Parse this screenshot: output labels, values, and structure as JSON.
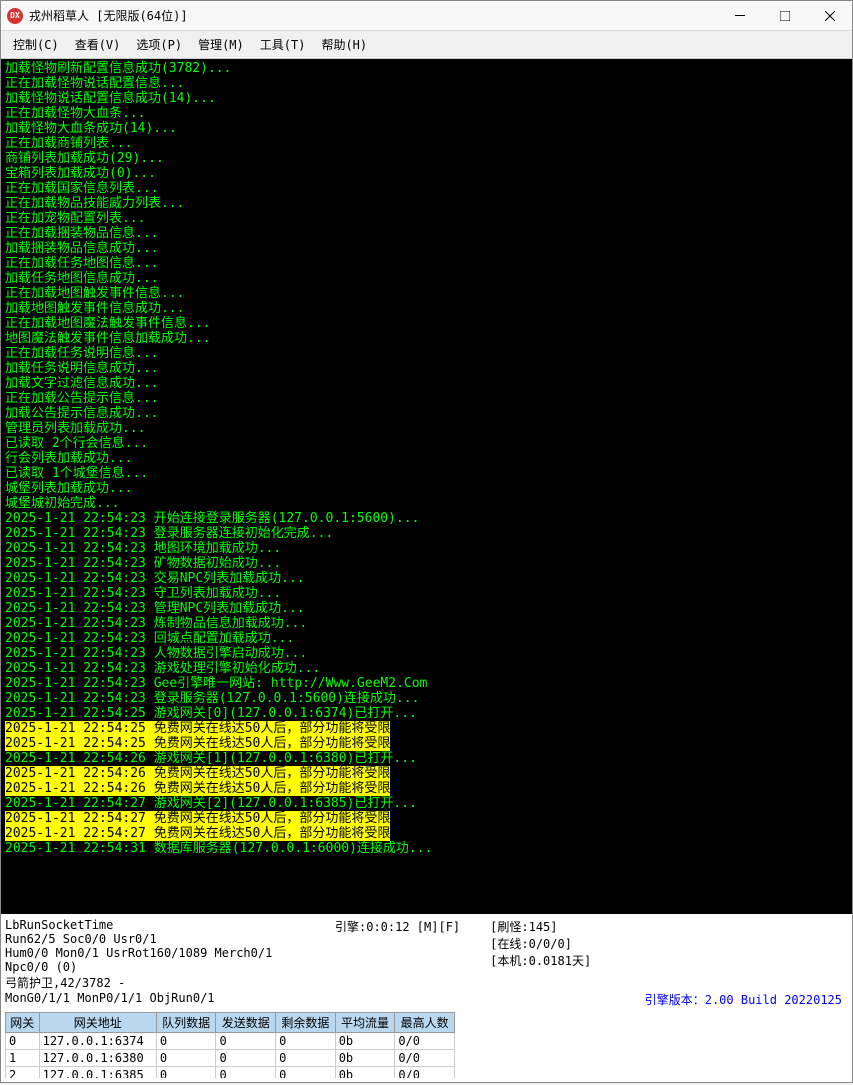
{
  "window": {
    "app_icon": "DX",
    "title": "戎州稻草人 [无限版(64位)]"
  },
  "menu": {
    "control": "控制(C)",
    "view": "查看(V)",
    "options": "选项(P)",
    "manage": "管理(M)",
    "tools": "工具(T)",
    "help": "帮助(H)"
  },
  "log_lines": [
    {
      "t": "加载怪物刷新配置信息成功(3782)...",
      "hl": false
    },
    {
      "t": "正在加载怪物说话配置信息...",
      "hl": false
    },
    {
      "t": "加载怪物说话配置信息成功(14)...",
      "hl": false
    },
    {
      "t": "正在加载怪物大血条...",
      "hl": false
    },
    {
      "t": "加载怪物大血条成功(14)...",
      "hl": false
    },
    {
      "t": "正在加载商铺列表...",
      "hl": false
    },
    {
      "t": "商铺列表加载成功(29)...",
      "hl": false
    },
    {
      "t": "宝箱列表加载成功(0)...",
      "hl": false
    },
    {
      "t": "正在加载国家信息列表...",
      "hl": false
    },
    {
      "t": "正在加载物品技能威力列表...",
      "hl": false
    },
    {
      "t": "正在加宠物配置列表...",
      "hl": false
    },
    {
      "t": "正在加载捆装物品信息...",
      "hl": false
    },
    {
      "t": "加载捆装物品信息成功...",
      "hl": false
    },
    {
      "t": "正在加载任务地图信息...",
      "hl": false
    },
    {
      "t": "加载任务地图信息成功...",
      "hl": false
    },
    {
      "t": "正在加载地图触发事件信息...",
      "hl": false
    },
    {
      "t": "加载地图触发事件信息成功...",
      "hl": false
    },
    {
      "t": "正在加载地图魔法触发事件信息...",
      "hl": false
    },
    {
      "t": "地图魔法触发事件信息加载成功...",
      "hl": false
    },
    {
      "t": "正在加载任务说明信息...",
      "hl": false
    },
    {
      "t": "加载任务说明信息成功...",
      "hl": false
    },
    {
      "t": "加载文字过滤信息成功...",
      "hl": false
    },
    {
      "t": "正在加载公告提示信息...",
      "hl": false
    },
    {
      "t": "加载公告提示信息成功...",
      "hl": false
    },
    {
      "t": "管理员列表加载成功...",
      "hl": false
    },
    {
      "t": "已读取 2个行会信息...",
      "hl": false
    },
    {
      "t": "行会列表加载成功...",
      "hl": false
    },
    {
      "t": "已读取 1个城堡信息...",
      "hl": false
    },
    {
      "t": "城堡列表加载成功...",
      "hl": false
    },
    {
      "t": "城堡城初始完成...",
      "hl": false
    },
    {
      "t": "2025-1-21 22:54:23 开始连接登录服务器(127.0.0.1:5600)...",
      "hl": false
    },
    {
      "t": "2025-1-21 22:54:23 登录服务器连接初始化完成...",
      "hl": false
    },
    {
      "t": "2025-1-21 22:54:23 地图环境加载成功...",
      "hl": false
    },
    {
      "t": "2025-1-21 22:54:23 矿物数据初始成功...",
      "hl": false
    },
    {
      "t": "2025-1-21 22:54:23 交易NPC列表加载成功...",
      "hl": false
    },
    {
      "t": "2025-1-21 22:54:23 守卫列表加载成功...",
      "hl": false
    },
    {
      "t": "2025-1-21 22:54:23 管理NPC列表加载成功...",
      "hl": false
    },
    {
      "t": "2025-1-21 22:54:23 炼制物品信息加载成功...",
      "hl": false
    },
    {
      "t": "2025-1-21 22:54:23 回城点配置加载成功...",
      "hl": false
    },
    {
      "t": "2025-1-21 22:54:23 人物数据引擎启动成功...",
      "hl": false
    },
    {
      "t": "2025-1-21 22:54:23 游戏处理引擎初始化成功...",
      "hl": false
    },
    {
      "t": "2025-1-21 22:54:23 Gee引擎唯一网站: http://Www.GeeM2.Com",
      "hl": false
    },
    {
      "t": "2025-1-21 22:54:23 登录服务器(127.0.0.1:5600)连接成功...",
      "hl": false
    },
    {
      "t": "2025-1-21 22:54:25 游戏网关[0](127.0.0.1:6374)已打开...",
      "hl": false
    },
    {
      "t": "2025-1-21 22:54:25 免费网关在线达50人后，部分功能将受限",
      "hl": true
    },
    {
      "t": "2025-1-21 22:54:25 免费网关在线达50人后，部分功能将受限",
      "hl": true
    },
    {
      "t": "2025-1-21 22:54:26 游戏网关[1](127.0.0.1:6380)已打开...",
      "hl": false
    },
    {
      "t": "2025-1-21 22:54:26 免费网关在线达50人后，部分功能将受限",
      "hl": true
    },
    {
      "t": "2025-1-21 22:54:26 免费网关在线达50人后，部分功能将受限",
      "hl": true
    },
    {
      "t": "2025-1-21 22:54:27 游戏网关[2](127.0.0.1:6385)已打开...",
      "hl": false
    },
    {
      "t": "2025-1-21 22:54:27 免费网关在线达50人后，部分功能将受限",
      "hl": true
    },
    {
      "t": "2025-1-21 22:54:27 免费网关在线达50人后，部分功能将受限",
      "hl": true
    },
    {
      "t": "2025-1-21 22:54:31 数据库服务器(127.0.0.1:6000)连接成功...",
      "hl": false
    }
  ],
  "status": {
    "col1": [
      "LbRunSocketTime",
      "Run62/5 Soc0/0 Usr0/1",
      "Hum0/0 Mon0/1 UsrRot160/1089 Merch0/1 Npc0/0 (0)",
      "弓箭护卫,42/3782 -",
      "MonG0/1/1 MonP0/1/1 ObjRun0/1"
    ],
    "col2": "引擎:0:0:12 [M][F]",
    "col3": [
      "[刷怪:145]",
      "[在线:0/0/0]",
      "[本机:0.0181天]"
    ],
    "engine_version": "引擎版本：2.00 Build 20220125"
  },
  "grid": {
    "headers": [
      "网关",
      "网关地址",
      "队列数据",
      "发送数据",
      "剩余数据",
      "平均流量",
      "最高人数"
    ],
    "rows": [
      [
        "0",
        "127.0.0.1:6374",
        "0",
        "0",
        "0",
        "0b",
        "0/0"
      ],
      [
        "1",
        "127.0.0.1:6380",
        "0",
        "0",
        "0",
        "0b",
        "0/0"
      ],
      [
        "2",
        "127.0.0.1:6385",
        "0",
        "0",
        "0",
        "0b",
        "0/0"
      ]
    ]
  }
}
